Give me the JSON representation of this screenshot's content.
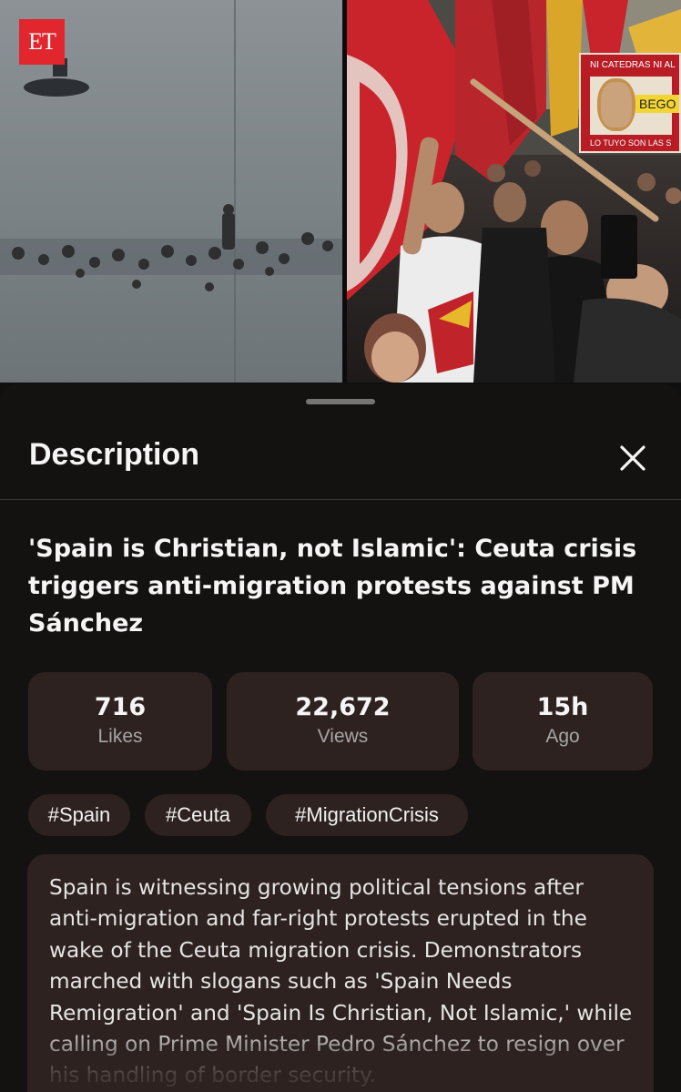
{
  "video": {
    "logo_text": "ET",
    "sign_top": "NI CATEDRAS NI AL",
    "sign_name": "BEGO",
    "sign_bottom": "LO TUYO SON LAS S"
  },
  "sheet": {
    "title": "Description",
    "close_icon": "close-icon"
  },
  "video_title": "'Spain is Christian, not Islamic': Ceuta crisis triggers anti-migration protests against PM Sánchez",
  "stats": [
    {
      "value": "716",
      "label": "Likes"
    },
    {
      "value": "22,672",
      "label": "Views"
    },
    {
      "value": "15h",
      "label": "Ago"
    }
  ],
  "tags": [
    "#Spain",
    "#Ceuta",
    "#MigrationCrisis"
  ],
  "description": "Spain is witnessing growing political tensions after anti-migration and far-right protests erupted in the wake of the Ceuta migration crisis. Demonstrators marched with slogans such as 'Spain Needs Remigration' and 'Spain Is Christian, Not Islamic,' while calling on Prime Minister Pedro Sánchez to resign over his handling of border security.",
  "colors": {
    "sheet_bg": "#141111",
    "card_bg": "#2e2220",
    "logo_red": "#e1262d"
  }
}
